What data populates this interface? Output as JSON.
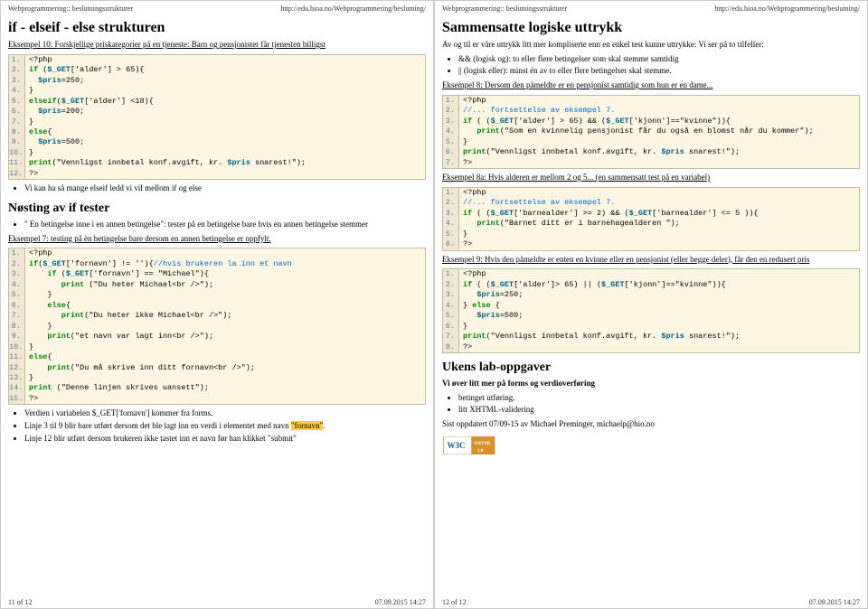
{
  "header": {
    "title": "Webprogrammering:: beslutningsstrukturer",
    "url": "http://edu.hioa.no/Webprogrammering/beslutning/"
  },
  "left": {
    "h1": "if - elseif - else strukturen",
    "ex10_title": "Eksempel 10: Forskjellige priskategorier på en tjeneste: Barn og pensjonister får tjenesten billigst",
    "code1": [
      "<?php",
      "if ($_GET['alder'] > 65){",
      "  $pris=250;",
      "}",
      "elseif($_GET['alder'] <18){",
      "  $pris=200;",
      "}",
      "else{",
      "  $pris=500;",
      "}",
      "print(\"Vennligst innbetal konf.avgift, kr. $pris snarest!\");",
      "?>"
    ],
    "note1": "Vi kan ha så mange elseif ledd vi vil mellom if og else",
    "h2": "Nøsting av if tester",
    "nest_bullet": "\" En betingelse inne i en annen betingelse\": tester på en betingelse bare hvis en annen betingelse stemmer",
    "ex7_title": "Eksempel 7: testing på èn betingelse bare dersom en annen betingelse er oppfylt.",
    "code2": [
      "<?php",
      "if($_GET['fornavn'] != ''){//hvis brukeren la inn et navn",
      "    if ($_GET['fornavn'] == \"Michael\"){",
      "       print (\"Du heter Michael<br />\");",
      "    }",
      "    else{",
      "       print(\"Du heter ikke Michael<br />\");",
      "    }",
      "    print(\"et navn var lagt inn<br />\");",
      "}",
      "else{",
      "    print(\"Du må skrive inn ditt fornavn<br />\");",
      "}",
      "print (\"Denne linjen skrives uansett\");",
      "?>"
    ],
    "bul2a": "Verdien i variabelen $_GET['fornavn'] kommer fra forms.",
    "bul2b_pre": "Linje 3 til 9 blir bare utført dersom det ble lagt inn en verdi i elementet med navn ",
    "bul2b_hl": "\"fornavn\"",
    "bul2b_post": ".",
    "bul2c": "Linje 12 blir utført dersom brukeren ikke tastet inn et navn før han klikket \"submit\"",
    "footer_page": "11 of 12",
    "footer_time": "07.09.2015 14:27"
  },
  "right": {
    "h1": "Sammensatte logiske uttrykk",
    "intro": "Av og til er våre uttrykk litt mer kompliserte enn en enkel test kunne uttrykke: Vi ser på to tilfeller:",
    "b1": "&& (logisk og): to eller flere betingelser som skal stemme samtidig",
    "b2": "|| (logisk eller): minst én av to eller flere betingelser skal stemme.",
    "ex8_title": "Eksempel 8: Dersom den påmeldte er en pensjonist samtidig som hun er en dame...",
    "code3": [
      "<?php",
      "//... fortsettelse av eksempel 7.",
      "if ( ($_GET['alder'] > 65) && ($_GET['kjonn']==\"kvinne\")){",
      "   print(\"Som en kvinnelig pensjonist får du også en blomst når du kommer\");",
      "}",
      "print(\"Vennligst innbetal konf.avgift, kr. $pris snarest!\");",
      "?>"
    ],
    "ex8a_title": "Eksempel 8a: Hvis alderen er mellom 2 og 5... (en sammensatt test på en variabel)",
    "code4": [
      "<?php",
      "//... fortsettelse av eksempel 7.",
      "if ( ($_GET['barnealder'] >= 2) && ($_GET['barnealder'] <= 5 )){",
      "   print(\"Barnet ditt er i barnehagealderen \");",
      "}",
      "?>"
    ],
    "ex9_title": "Eksempel 9: Hvis den påmeldte er enten en kvinne eller en pensjonist (eller begge deler), får den en redusert pris",
    "code5": [
      "<?php",
      "if ( ($_GET['alder']> 65) || ($_GET['kjonn']==\"kvinne\")){",
      "   $pris=250;",
      "} else {",
      "   $pris=500;",
      "}",
      "print(\"Vennligst innbetal konf.avgift, kr. $pris snarest!\");",
      "?>"
    ],
    "h2": "Ukens lab-oppgaver",
    "lab_intro": "Vi øver litt mer på forms og verdioverføring",
    "lab_b1": "betinget utføring.",
    "lab_b2": "litt XHTML-validering",
    "updated": "Sist oppdatert 07/09-15 av Michael Preminger, michaelp@hio.no",
    "footer_page": "12 of 12",
    "footer_time": "07.09.2015 14:27"
  }
}
